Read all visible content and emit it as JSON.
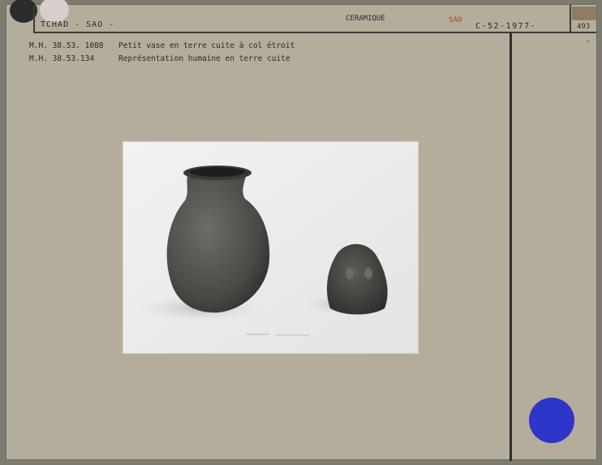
{
  "header": {
    "region": "TCHAD -   SAO -",
    "category": "CERAMIQUE",
    "culture": "SAO",
    "code": "C-52-1977-",
    "number": "493"
  },
  "items": [
    {
      "ref": "M.H. 38.53. 1088",
      "description": "Petit vase en terre cuite à col étroit"
    },
    {
      "ref": "M.H. 38.53.134",
      "description": "Représentation humaine en terre cuite"
    }
  ],
  "colors": {
    "card": "#b5ad9b",
    "culture_stamp": "#b53a2a",
    "blue_dot": "#2d35c9"
  }
}
